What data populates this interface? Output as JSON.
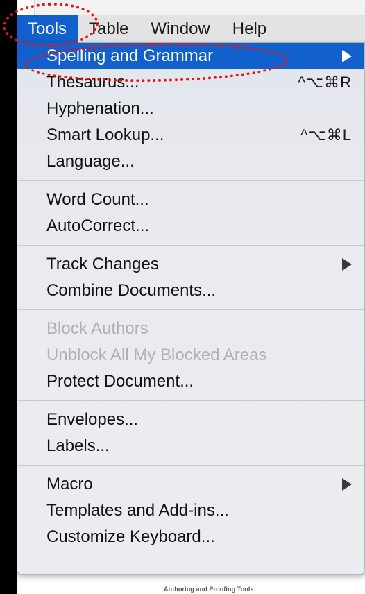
{
  "app": {
    "context_label": "Authoring and Proofing Tools"
  },
  "menubar": {
    "items": [
      {
        "label": "Tools",
        "active": true
      },
      {
        "label": "Table",
        "active": false
      },
      {
        "label": "Window",
        "active": false
      },
      {
        "label": "Help",
        "active": false
      }
    ]
  },
  "menu": {
    "title": "Tools",
    "groups": [
      {
        "items": [
          {
            "label": "Spelling and Grammar",
            "shortcut": "",
            "submenu": true,
            "disabled": false,
            "selected": true
          },
          {
            "label": "Thesaurus...",
            "shortcut": "^⌥⌘R",
            "submenu": false,
            "disabled": false,
            "selected": false
          },
          {
            "label": "Hyphenation...",
            "shortcut": "",
            "submenu": false,
            "disabled": false,
            "selected": false
          },
          {
            "label": "Smart Lookup...",
            "shortcut": "^⌥⌘L",
            "submenu": false,
            "disabled": false,
            "selected": false
          },
          {
            "label": "Language...",
            "shortcut": "",
            "submenu": false,
            "disabled": false,
            "selected": false
          }
        ]
      },
      {
        "items": [
          {
            "label": "Word Count...",
            "shortcut": "",
            "submenu": false,
            "disabled": false,
            "selected": false
          },
          {
            "label": "AutoCorrect...",
            "shortcut": "",
            "submenu": false,
            "disabled": false,
            "selected": false
          }
        ]
      },
      {
        "items": [
          {
            "label": "Track Changes",
            "shortcut": "",
            "submenu": true,
            "disabled": false,
            "selected": false
          },
          {
            "label": "Combine Documents...",
            "shortcut": "",
            "submenu": false,
            "disabled": false,
            "selected": false
          }
        ]
      },
      {
        "items": [
          {
            "label": "Block Authors",
            "shortcut": "",
            "submenu": false,
            "disabled": true,
            "selected": false
          },
          {
            "label": "Unblock All My Blocked Areas",
            "shortcut": "",
            "submenu": false,
            "disabled": true,
            "selected": false
          },
          {
            "label": "Protect Document...",
            "shortcut": "",
            "submenu": false,
            "disabled": false,
            "selected": false
          }
        ]
      },
      {
        "items": [
          {
            "label": "Envelopes...",
            "shortcut": "",
            "submenu": false,
            "disabled": false,
            "selected": false
          },
          {
            "label": "Labels...",
            "shortcut": "",
            "submenu": false,
            "disabled": false,
            "selected": false
          }
        ]
      },
      {
        "items": [
          {
            "label": "Macro",
            "shortcut": "",
            "submenu": true,
            "disabled": false,
            "selected": false
          },
          {
            "label": "Templates and Add-ins...",
            "shortcut": "",
            "submenu": false,
            "disabled": false,
            "selected": false
          },
          {
            "label": "Customize Keyboard...",
            "shortcut": "",
            "submenu": false,
            "disabled": false,
            "selected": false
          }
        ]
      }
    ]
  },
  "annotations": [
    {
      "name": "tools-menu-highlight",
      "shape": "dotted-ellipse",
      "color": "#ee1111"
    },
    {
      "name": "spelling-and-grammar-highlight",
      "shape": "dotted-ellipse",
      "color": "#ee1111"
    }
  ],
  "colors": {
    "highlight": "#1160cc",
    "menubar_bg": "#e3e3e3",
    "menu_bg": "#e9ebf0",
    "annotation": "#ee1111",
    "disabled_text": "#adb0b5"
  }
}
